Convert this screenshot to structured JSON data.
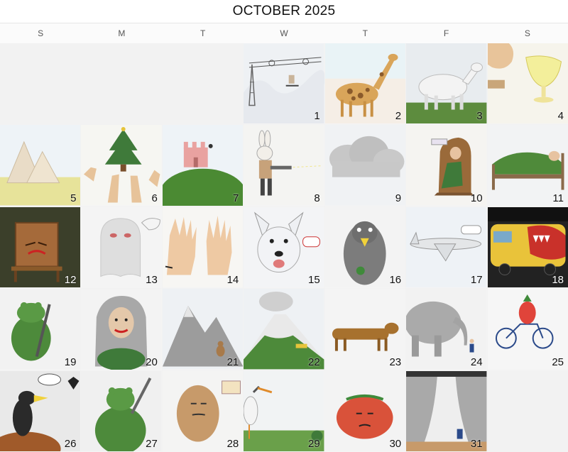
{
  "calendar": {
    "title": "OCTOBER 2025",
    "weekdays": [
      "S",
      "M",
      "T",
      "W",
      "T",
      "F",
      "S"
    ],
    "days": [
      {
        "label": "1",
        "scene": "power-line-icon"
      },
      {
        "label": "2",
        "scene": "giraffe-icon"
      },
      {
        "label": "3",
        "scene": "white-goat-icon"
      },
      {
        "label": "4",
        "scene": "hand-and-goblet-icon"
      },
      {
        "label": "5",
        "scene": "pyramid-icon"
      },
      {
        "label": "6",
        "scene": "christmas-tree-hands-icon"
      },
      {
        "label": "7",
        "scene": "castle-hill-icon"
      },
      {
        "label": "8",
        "scene": "rabbit-with-gun-icon"
      },
      {
        "label": "9",
        "scene": "cloud-icon"
      },
      {
        "label": "10",
        "scene": "man-in-armchair-icon"
      },
      {
        "label": "11",
        "scene": "person-in-bed-icon"
      },
      {
        "label": "12",
        "scene": "angry-chair-icon"
      },
      {
        "label": "13",
        "scene": "ghost-icon"
      },
      {
        "label": "14",
        "scene": "two-hands-icon"
      },
      {
        "label": "15",
        "scene": "white-dog-icon"
      },
      {
        "label": "16",
        "scene": "penguin-icon"
      },
      {
        "label": "17",
        "scene": "airplane-icon"
      },
      {
        "label": "18",
        "scene": "painted-bus-icon"
      },
      {
        "label": "19",
        "scene": "frog-with-sword-icon"
      },
      {
        "label": "20",
        "scene": "long-haired-woman-icon"
      },
      {
        "label": "21",
        "scene": "mountain-and-bear-icon"
      },
      {
        "label": "22",
        "scene": "volcano-icon"
      },
      {
        "label": "23",
        "scene": "dachshund-icon"
      },
      {
        "label": "24",
        "scene": "elephant-and-child-icon"
      },
      {
        "label": "25",
        "scene": "strawberry-cyclist-icon"
      },
      {
        "label": "26",
        "scene": "bird-with-speech-bubble-icon"
      },
      {
        "label": "27",
        "scene": "green-creature-with-sword-icon"
      },
      {
        "label": "28",
        "scene": "potato-face-icon"
      },
      {
        "label": "29",
        "scene": "stork-icon"
      },
      {
        "label": "30",
        "scene": "tomato-face-icon"
      },
      {
        "label": "31",
        "scene": "stage-curtain-icon"
      }
    ]
  }
}
